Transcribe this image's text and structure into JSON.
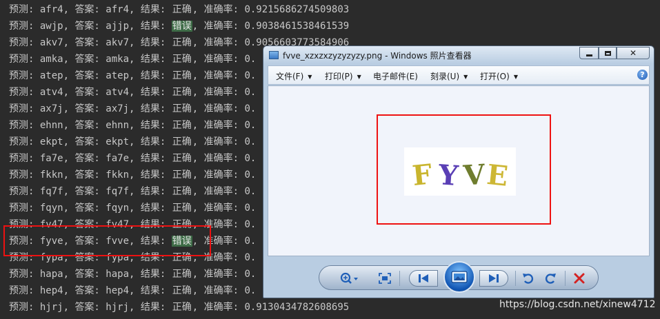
{
  "console": {
    "lines": [
      {
        "pred": "afr4",
        "ans": "afr4",
        "result": "正确",
        "acc": "0.9215686274509803",
        "wrong": false
      },
      {
        "pred": "awjp",
        "ans": "ajjp",
        "result": "错误",
        "acc": "0.9038461538461539",
        "wrong": true
      },
      {
        "pred": "akv7",
        "ans": "akv7",
        "result": "正确",
        "acc": "0.9056603773584906",
        "wrong": false
      },
      {
        "pred": "amka",
        "ans": "amka",
        "result": "正确",
        "acc": "0.",
        "wrong": false
      },
      {
        "pred": "atep",
        "ans": "atep",
        "result": "正确",
        "acc": "0.",
        "wrong": false
      },
      {
        "pred": "atv4",
        "ans": "atv4",
        "result": "正确",
        "acc": "0.",
        "wrong": false
      },
      {
        "pred": "ax7j",
        "ans": "ax7j",
        "result": "正确",
        "acc": "0.",
        "wrong": false
      },
      {
        "pred": "ehnn",
        "ans": "ehnn",
        "result": "正确",
        "acc": "0.",
        "wrong": false
      },
      {
        "pred": "ekpt",
        "ans": "ekpt",
        "result": "正确",
        "acc": "0.",
        "wrong": false
      },
      {
        "pred": "fa7e",
        "ans": "fa7e",
        "result": "正确",
        "acc": "0.",
        "wrong": false
      },
      {
        "pred": "fkkn",
        "ans": "fkkn",
        "result": "正确",
        "acc": "0.",
        "wrong": false
      },
      {
        "pred": "fq7f",
        "ans": "fq7f",
        "result": "正确",
        "acc": "0.",
        "wrong": false
      },
      {
        "pred": "fqyn",
        "ans": "fqyn",
        "result": "正确",
        "acc": "0.",
        "wrong": false
      },
      {
        "pred": "fv47",
        "ans": "fv47",
        "result": "正确",
        "acc": "0.",
        "wrong": false
      },
      {
        "pred": "fyve",
        "ans": "fvve",
        "result": "错误",
        "acc": "0.",
        "wrong": true
      },
      {
        "pred": "fypa",
        "ans": "fypa",
        "result": "正确",
        "acc": "0.",
        "wrong": false
      },
      {
        "pred": "hapa",
        "ans": "hapa",
        "result": "正确",
        "acc": "0.",
        "wrong": false
      },
      {
        "pred": "hep4",
        "ans": "hep4",
        "result": "正确",
        "acc": "0.",
        "wrong": false
      },
      {
        "pred": "hjrj",
        "ans": "hjrj",
        "result": "正确",
        "acc": "0.9130434782608695",
        "wrong": false
      }
    ],
    "labels": {
      "pred": "预测: ",
      "ans": "答案: ",
      "result": "结果: ",
      "acc": "准确率: ",
      "sep": ", "
    }
  },
  "viewer": {
    "title": "fvve_xzxzxzyzyzyzy.png - Windows 照片查看器",
    "menu": [
      {
        "label": "文件(F)",
        "has_arrow": true
      },
      {
        "label": "打印(P)",
        "has_arrow": true
      },
      {
        "label": "电子邮件(E)",
        "has_arrow": false
      },
      {
        "label": "刻录(U)",
        "has_arrow": true
      },
      {
        "label": "打开(O)",
        "has_arrow": true
      }
    ],
    "help_glyph": "?",
    "captcha_letters": [
      {
        "char": "F",
        "color": "#c9b52e"
      },
      {
        "char": "Y",
        "color": "#5a3fb5"
      },
      {
        "char": "V",
        "color": "#6f7d2e"
      },
      {
        "char": "E",
        "color": "#cdb735"
      }
    ],
    "window_buttons": {
      "minimize_icon": "minimize-icon",
      "maximize_icon": "maximize-icon",
      "close_icon": "close-icon"
    },
    "controls": [
      "zoom-icon",
      "actual-size-icon",
      "previous-icon",
      "slideshow-icon",
      "next-icon",
      "rotate-ccw-icon",
      "rotate-cw-icon",
      "delete-icon"
    ]
  },
  "watermark": "https://blog.csdn.net/xinew4712",
  "colors": {
    "console_bg": "#2b2b2b",
    "console_text": "#c8c8c8",
    "wrong_bg": "#3d6b46",
    "highlight": "#ee1111"
  }
}
